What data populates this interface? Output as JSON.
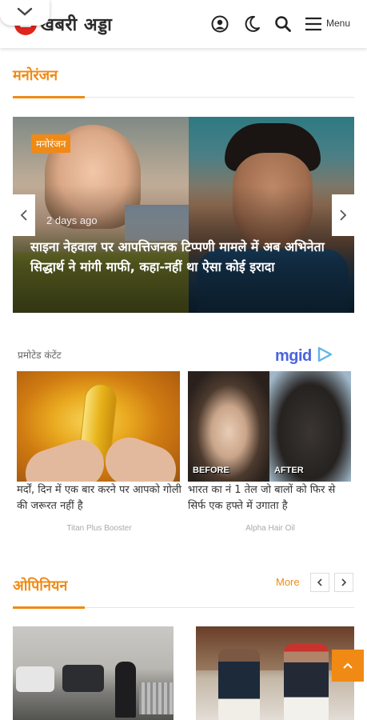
{
  "header": {
    "logo_text": "खबरी अड्डा",
    "menu_label": "Menu",
    "icons": [
      "chevron-down-icon",
      "user-icon",
      "moon-icon",
      "search-icon",
      "hamburger-icon"
    ]
  },
  "sections": {
    "entertainment": {
      "title": "मनोरंजन",
      "slide": {
        "category": "मनोरंजन",
        "time": "2 days ago",
        "title": "साइना नेहवाल पर आपत्तिजनक टिप्पणी मामले में अब अभिनेता सिद्धार्थ ने मांगी माफी, कहा-नहीं था ऐसा कोई इरादा"
      }
    },
    "promoted": {
      "label": "प्रमोटेड कंटेंट",
      "provider": "mgid",
      "items": [
        {
          "title": "मर्दों, दिन में एक बार करने पर आपको गोली की जरूरत नहीं है",
          "source": "Titan Plus Booster"
        },
        {
          "title": "भारत का नं 1 तेल जो बालों को फिर से सिर्फ एक हफ्ते में उगाता है",
          "source": "Alpha Hair Oil",
          "before_label": "BEFORE",
          "after_label": "AFTER"
        }
      ]
    },
    "opinion": {
      "title": "ओपिनियन",
      "more_label": "More"
    }
  },
  "colors": {
    "accent": "#f08a14",
    "mgid_blue": "#4a63e0"
  }
}
